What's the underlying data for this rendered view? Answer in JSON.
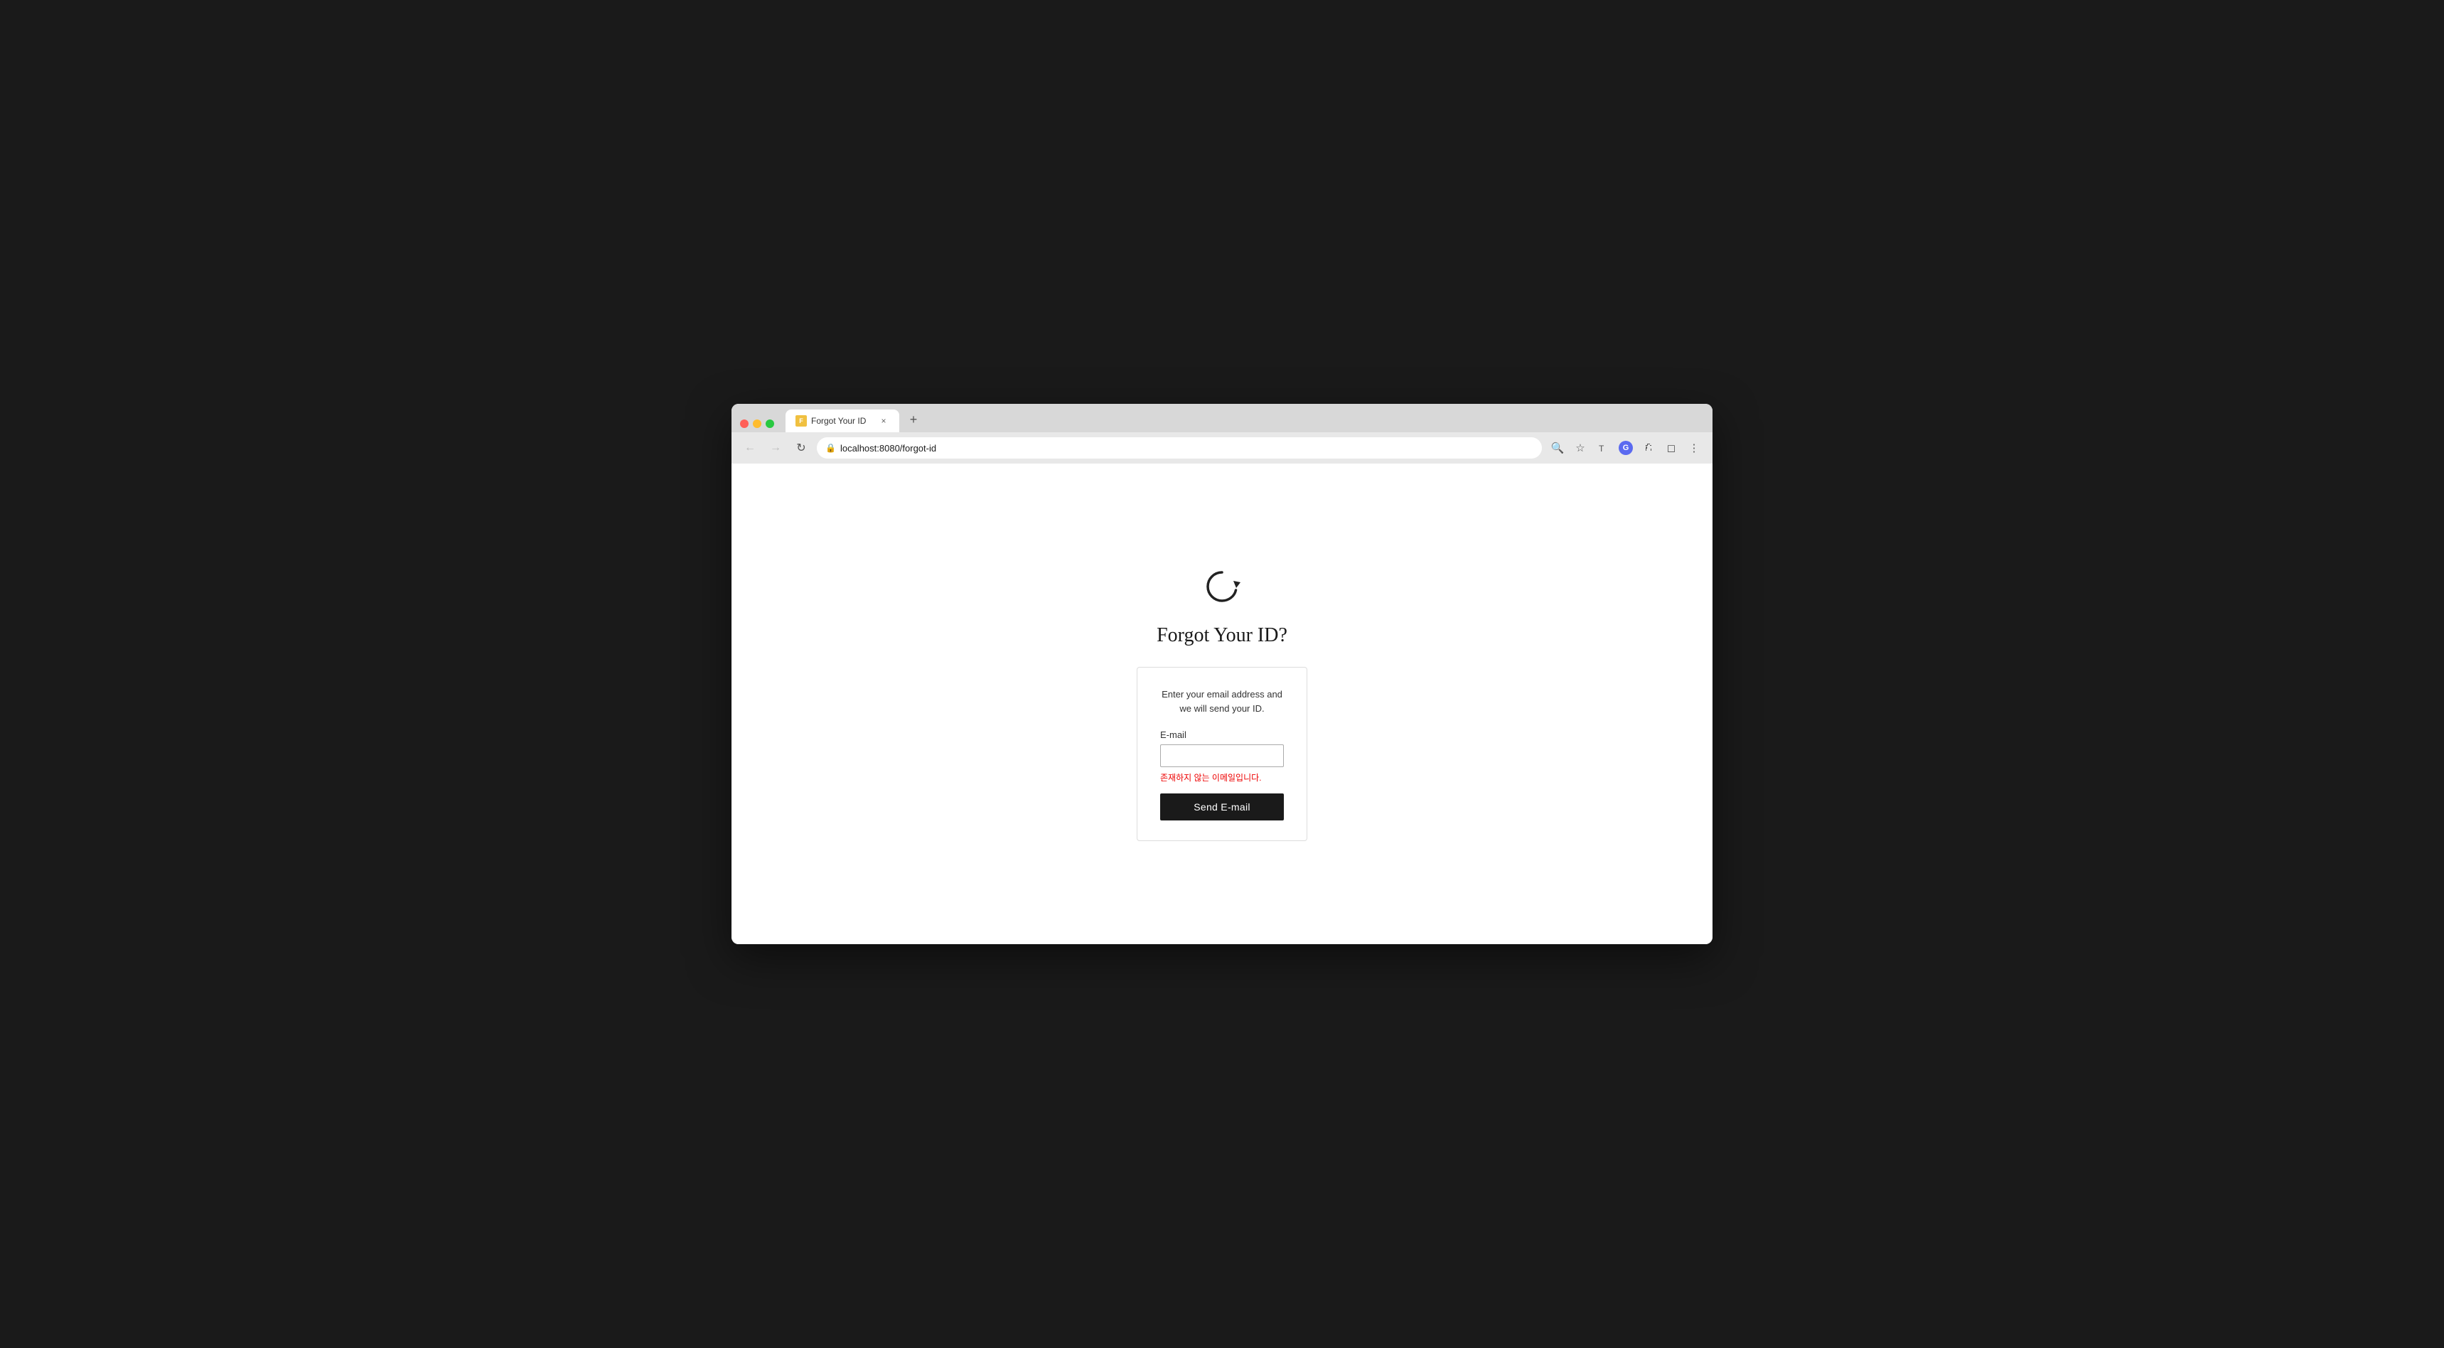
{
  "browser": {
    "tab": {
      "favicon_label": "F",
      "title": "Forgot Your ID",
      "close_label": "×",
      "new_tab_label": "+"
    },
    "nav": {
      "back_label": "←",
      "forward_label": "→",
      "reload_label": "↻"
    },
    "address_bar": {
      "url": "localhost:8080/forgot-id",
      "lock_icon": "🔒"
    },
    "toolbar_icons": {
      "search": "🔍",
      "bookmark": "☆",
      "translate": "T",
      "profile": "G",
      "extensions": "🧩",
      "media": "▷",
      "menu": "⋮"
    }
  },
  "page": {
    "icon": "↻",
    "heading": "Forgot Your ID?",
    "form": {
      "description": "Enter your email address and we will send your ID.",
      "email_label": "E-mail",
      "email_placeholder": "",
      "error_message": "존재하지 않는 이메일입니다.",
      "submit_label": "Send E-mail"
    }
  }
}
